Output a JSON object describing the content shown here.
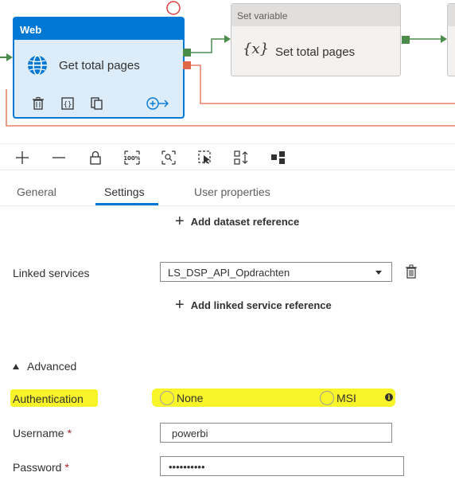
{
  "canvas": {
    "web_activity": {
      "type_label": "Web",
      "title": "Get total pages",
      "tool_icons": [
        "trash-icon",
        "code-icon",
        "copy-icon"
      ],
      "add_output_icon": "add-output-arrow-icon"
    },
    "set_activity": {
      "type_label": "Set variable",
      "glyph": "{x}",
      "title": "Set total pages"
    },
    "colors": {
      "accent": "#0078d4",
      "success_port": "#4c8c4a",
      "failure_port": "#e06648",
      "failure_line": "#e06648",
      "selected_bg": "#dcecf9"
    }
  },
  "toolbar": {
    "icons": [
      "plus-icon",
      "minus-icon",
      "lock-icon",
      "zoom-100-icon",
      "zoom-fit-icon",
      "select-icon",
      "auto-align-icon",
      "layout-icon"
    ],
    "zoom_label": "100%"
  },
  "tabs": [
    {
      "label": "General",
      "active": false
    },
    {
      "label": "Settings",
      "active": true
    },
    {
      "label": "User properties",
      "active": false
    }
  ],
  "settings": {
    "add_dataset_label": "Add dataset reference",
    "linked_services_label": "Linked services",
    "linked_service_value": "LS_DSP_API_Opdrachten",
    "add_linked_service_label": "Add linked service reference",
    "advanced_label": "Advanced",
    "authentication_label": "Authentication",
    "auth_options": [
      "None",
      "MSI"
    ],
    "info_glyph": "i",
    "username_label": "Username",
    "username_value": "powerbi",
    "password_label": "Password",
    "password_value": "••••••••••",
    "required_mark": "*",
    "highlight_color": "#f7f42a"
  }
}
